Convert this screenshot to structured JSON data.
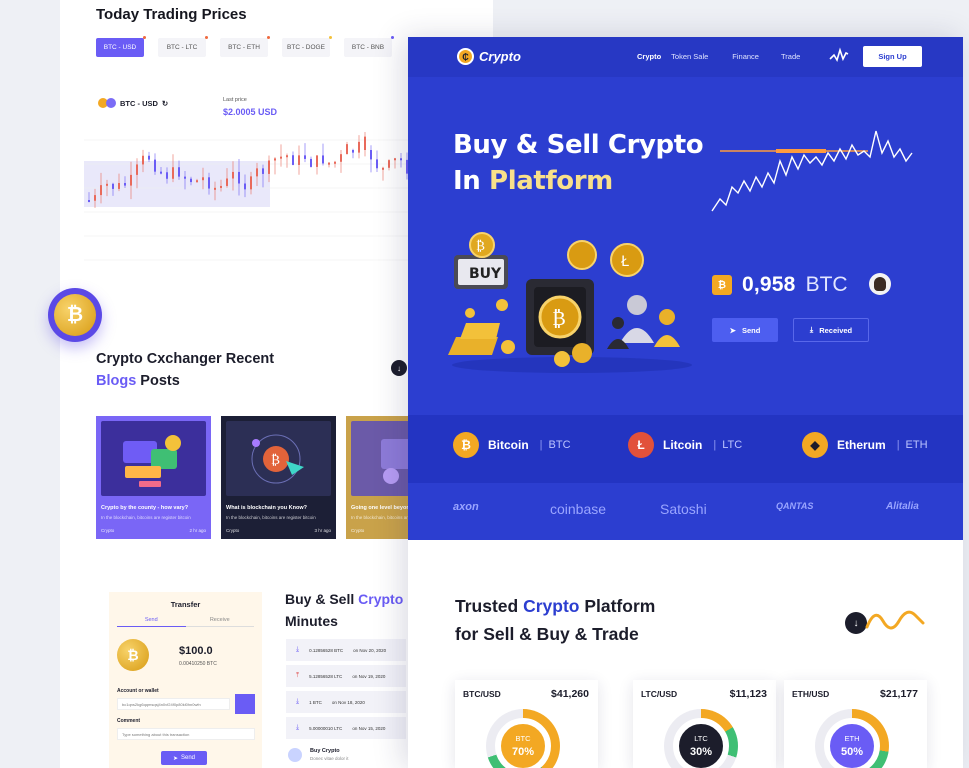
{
  "back": {
    "trading_title": "Today Trading Prices",
    "pairs": [
      "BTC - USD",
      "BTC - LTC",
      "BTC - ETH",
      "BTC - DOGE",
      "BTC - BNB"
    ],
    "chart_pair": "BTC - USD",
    "last_price_label": "Last price",
    "last_price": "$2.0005 USD",
    "blogs_title_1": "Crypto Cxchanger Recent",
    "blogs_title_accent": "Blogs",
    "blogs_title_2": " Posts",
    "blogs": [
      {
        "title": "Crypto by the county - how vary?",
        "sub": "In the blockchain, bitcoins are register bitcoin",
        "tag": "Crypto",
        "time": "2 hr ago"
      },
      {
        "title": "What is blockchain  you Know?",
        "sub": "In the blockchain, bitcoins are register bitcoin",
        "tag": "Crypto",
        "time": "3 hr ago"
      },
      {
        "title": "Going one level beyond",
        "sub": "In the blockchain, bitcoins are register",
        "tag": "Crypto",
        "time": ""
      }
    ],
    "transfer": {
      "title": "Transfer",
      "tab_send": "Send",
      "tab_receive": "Receive",
      "amount": "$100.0",
      "btc_amount": "0.00410250  BTC",
      "account_label": "Account or wallet",
      "account_value": "bc1qns2kg6qqmsqsj4n0vf24f0p80kl0hn0wfn",
      "comment_label": "Comment",
      "comment_placeholder": "Type something about this transaction",
      "send_label": "Send"
    },
    "bs_title_1": "Buy & Sell ",
    "bs_title_accent": "Crypto",
    "bs_title_2": "Minutes",
    "transactions": [
      {
        "amount": "0.12856528 BTC",
        "date": "on  Nov 20, 2020"
      },
      {
        "amount": "5.12856528 LTC",
        "date": "on  Nov 19, 2020"
      },
      {
        "amount": "1 BTC",
        "date": "on  Nov 18, 2020"
      },
      {
        "amount": "5.00000010 LTC",
        "date": "on  Nov 15, 2020"
      }
    ],
    "buy_crypto_title": "Buy Crypto",
    "buy_crypto_sub": "Donec vitae dolor it"
  },
  "front": {
    "logo": "Crypto",
    "nav": [
      "Crypto",
      "Token Sale",
      "Finance",
      "Trade"
    ],
    "signup": "Sign Up",
    "hero_line1": "Buy & Sell Crypto",
    "hero_line2_a": "In ",
    "hero_line2_accent": "Platform",
    "illus_buy": "BUY",
    "balance_value": "0,958",
    "balance_unit": "BTC",
    "send": "Send",
    "received": "Received",
    "coins": [
      {
        "name": "Bitcoin",
        "symbol": "BTC",
        "color": "#f3a823",
        "glyph": "₿"
      },
      {
        "name": "Litcoin",
        "symbol": "LTC",
        "color": "#e2513a",
        "glyph": "Ł"
      },
      {
        "name": "Etherum",
        "symbol": "ETH",
        "color": "#f3a823",
        "glyph": "◆"
      }
    ],
    "partners": [
      "axon",
      "coinbase",
      "Satoshi",
      "QANTAS",
      "Alitalia"
    ],
    "trusted_1": "Trusted ",
    "trusted_accent": "Crypto",
    "trusted_2": " Platform",
    "trusted_line2": "for Sell & Buy & Trade",
    "prices": [
      {
        "pair": "BTC/USD",
        "price": "$41,260",
        "symbol": "BTC",
        "pct": "70%",
        "fill": 0.7,
        "disc": "#f3a823"
      },
      {
        "pair": "LTC/USD",
        "price": "$11,123",
        "symbol": "LTC",
        "pct": "30%",
        "fill": 0.3,
        "disc": "#1c1d2b"
      },
      {
        "pair": "ETH/USD",
        "price": "$21,177",
        "symbol": "ETH",
        "pct": "50%",
        "fill": 0.5,
        "disc": "#6a5cf5"
      }
    ]
  },
  "colors": {
    "accent_purple": "#6a5cf5",
    "hero_blue": "#2c3ed0",
    "gold": "#f3a823",
    "hero_accent": "#f8e08a"
  }
}
